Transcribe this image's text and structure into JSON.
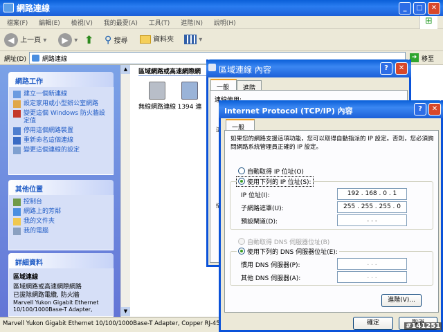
{
  "window": {
    "title": "網路連線"
  },
  "menu": [
    "檔案(F)",
    "編輯(E)",
    "檢視(V)",
    "我的最愛(A)",
    "工具(T)",
    "進階(N)",
    "說明(H)"
  ],
  "toolbar": {
    "back": "上一頁",
    "search": "搜尋",
    "folders": "資料夾"
  },
  "address": {
    "label": "網址(D)",
    "value": "網路連線",
    "go": "移至"
  },
  "tasks": {
    "title": "網路工作",
    "items": [
      "建立一個新連線",
      "設定家用或小型辦公室網路",
      "變更這個 Windows 防火牆設定值",
      "停用這個網路裝置",
      "重新命名這個連線",
      "變更這個連線的設定"
    ]
  },
  "places": {
    "title": "其他位置",
    "items": [
      "控制台",
      "網路上的芳鄰",
      "我的文件夾",
      "我的電腦"
    ]
  },
  "details": {
    "title": "詳細資料",
    "name": "區域連線",
    "lines": [
      "區域網路或高速網際網路",
      "已拔除網路電纜, 防火牆",
      "Marvell Yukon Gigabit Ethernet 10/100/1000Base-T Adapter,"
    ]
  },
  "content": {
    "header": "區域網路或高速網際網",
    "icons": [
      {
        "label": "無線網路連線"
      },
      {
        "label": "1394 連"
      }
    ]
  },
  "status": "Marvell Yukon Gigabit Ethernet 10/100/1000Base-T Adapter, Copper RJ-45",
  "dialog1": {
    "title": "區域連線 內容",
    "tabs": [
      "一般",
      "進階"
    ],
    "connect_label": "連線使用:",
    "frag": "這",
    "frag2": "描"
  },
  "dialog2": {
    "title": "Internet Protocol (TCP/IP) 內容",
    "tab": "一般",
    "desc": "如果您的網路支援這項功能，您可以取得自動指派的 IP 設定。否則，您必須詢問網路系統管理員正確的 IP 設定。",
    "auto_ip": "自動取得 IP 位址(O)",
    "use_ip": "使用下列的 IP 位址(S):",
    "ip_label": "IP 位址(I):",
    "ip_value": "192 . 168 . 0 . 1",
    "mask_label": "子網路遮罩(U):",
    "mask_value": "255 . 255 . 255 . 0",
    "gw_label": "預設閘道(D):",
    "gw_value": ". . .",
    "auto_dns": "自動取得 DNS 伺服器位址(B)",
    "use_dns": "使用下列的 DNS 伺服器位址(E):",
    "dns1_label": "慣用 DNS 伺服器(P):",
    "dns1_value": ". . .",
    "dns2_label": "其他 DNS 伺服器(A):",
    "dns2_value": ". . .",
    "advanced": "進階(V)...",
    "ok": "確定",
    "cancel": "取消"
  },
  "watermark": "#141251"
}
